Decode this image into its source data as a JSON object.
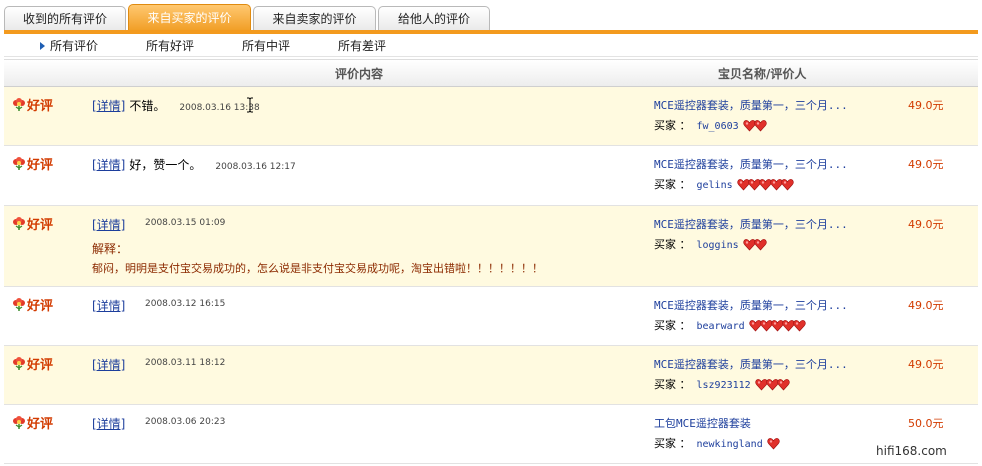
{
  "tabs": [
    {
      "label": "收到的所有评价",
      "active": false
    },
    {
      "label": "来自买家的评价",
      "active": true
    },
    {
      "label": "来自卖家的评价",
      "active": false
    },
    {
      "label": "给他人的评价",
      "active": false
    }
  ],
  "subnav": [
    "所有评价",
    "所有好评",
    "所有中评",
    "所有差评"
  ],
  "header": {
    "content": "评价内容",
    "item": "宝贝名称/评价人"
  },
  "rows": [
    {
      "rating": "好评",
      "detail": "[详情]",
      "comment": "不错。",
      "date": "2008.03.16 13:38",
      "item": "MCE遥控器套装，质量第一，三个月...",
      "price": "49.0元",
      "buyer_label": "买家 ：",
      "buyer": "fw_0603",
      "hearts": 2
    },
    {
      "rating": "好评",
      "detail": "[详情]",
      "comment": "好，赞一个。",
      "date": "2008.03.16 12:17",
      "item": "MCE遥控器套装，质量第一，三个月...",
      "price": "49.0元",
      "buyer_label": "买家 ：",
      "buyer": "gelins",
      "hearts": 5
    },
    {
      "rating": "好评",
      "detail": "[详情]",
      "comment": "",
      "date": "2008.03.15 01:09",
      "explain_label": "解释：",
      "explain_text": "郁闷，明明是支付宝交易成功的，怎么说是非支付宝交易成功呢，淘宝出错啦！！！！！！！",
      "item": "MCE遥控器套装，质量第一，三个月...",
      "price": "49.0元",
      "buyer_label": "买家 ：",
      "buyer": "loggins",
      "hearts": 2
    },
    {
      "rating": "好评",
      "detail": "[详情]",
      "comment": "",
      "date": "2008.03.12 16:15",
      "item": "MCE遥控器套装，质量第一，三个月...",
      "price": "49.0元",
      "buyer_label": "买家 ：",
      "buyer": "bearward",
      "hearts": 5
    },
    {
      "rating": "好评",
      "detail": "[详情]",
      "comment": "",
      "date": "2008.03.11 18:12",
      "item": "MCE遥控器套装，质量第一，三个月...",
      "price": "49.0元",
      "buyer_label": "买家 ：",
      "buyer": "lsz923112",
      "hearts": 3
    },
    {
      "rating": "好评",
      "detail": "[详情]",
      "comment": "",
      "date": "2008.03.06 20:23",
      "item": "工包MCE遥控器套装",
      "price": "50.0元",
      "buyer_label": "买家 ：",
      "buyer": "newkingland",
      "hearts": 1
    }
  ],
  "watermark": "hifi168.com",
  "colors": {
    "accent": "#f39a1e",
    "rating": "#d23b00",
    "link": "#1d3e9c",
    "row_highlight": "#fffae0"
  }
}
